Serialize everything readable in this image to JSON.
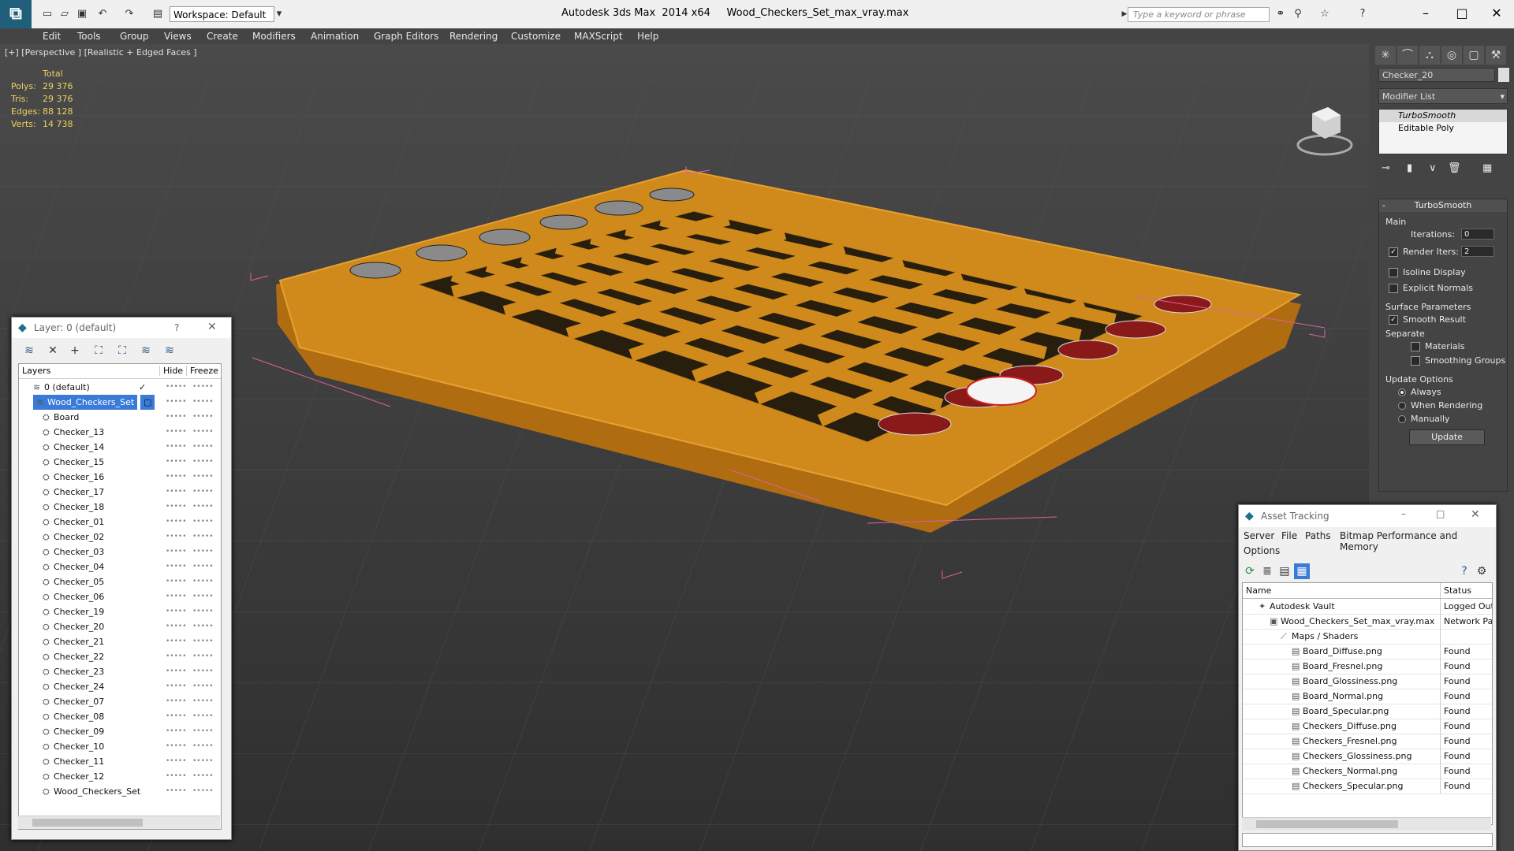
{
  "titlebar": {
    "app_title": "Autodesk 3ds Max  2014 x64     Wood_Checkers_Set_max_vray.max",
    "workspace": "Workspace: Default",
    "search_placeholder": "Type a keyword or phrase"
  },
  "menu": [
    "Edit",
    "Tools",
    "Group",
    "Views",
    "Create",
    "Modifiers",
    "Animation",
    "Graph Editors",
    "Rendering",
    "Customize",
    "MAXScript",
    "Help"
  ],
  "viewport": {
    "label": "[+] [Perspective ] [Realistic + Edged Faces ]",
    "stats": {
      "header": "Total",
      "polys_label": "Polys:",
      "polys": "29 376",
      "tris_label": "Tris:",
      "tris": "29 376",
      "edges_label": "Edges:",
      "edges": "88 128",
      "verts_label": "Verts:",
      "verts": "14 738"
    },
    "colors": {
      "board": "#d08a1c",
      "dark_square": "#0a0a0a",
      "checker_red": "#8a1a1a",
      "selection": "#e060a0"
    }
  },
  "command_panel": {
    "object_name": "Checker_20",
    "modifier_list": "Modifier List",
    "stack": [
      "TurboSmooth",
      "Editable Poly"
    ],
    "turbosmooth": {
      "title": "TurboSmooth",
      "main": "Main",
      "iterations_label": "Iterations:",
      "iterations": "0",
      "render_iters_label": "Render Iters:",
      "render_iters": "2",
      "isoline": "Isoline Display",
      "explicit_normals": "Explicit Normals",
      "surface_params": "Surface Parameters",
      "smooth_result": "Smooth Result",
      "separate": "Separate",
      "materials": "Materials",
      "smoothing_groups": "Smoothing Groups",
      "update_options": "Update Options",
      "always": "Always",
      "when_rendering": "When Rendering",
      "manually": "Manually",
      "update": "Update"
    }
  },
  "layer_dialog": {
    "title": "Layer: 0 (default)",
    "help": "?",
    "col_layers": "Layers",
    "col_hide": "Hide",
    "col_freeze": "Freeze",
    "rows": [
      {
        "name": "0 (default)",
        "level": 0
      },
      {
        "name": "Wood_Checkers_Set",
        "level": 0,
        "selected": true
      },
      {
        "name": "Board",
        "level": 1
      },
      {
        "name": "Checker_13",
        "level": 1
      },
      {
        "name": "Checker_14",
        "level": 1
      },
      {
        "name": "Checker_15",
        "level": 1
      },
      {
        "name": "Checker_16",
        "level": 1
      },
      {
        "name": "Checker_17",
        "level": 1
      },
      {
        "name": "Checker_18",
        "level": 1
      },
      {
        "name": "Checker_01",
        "level": 1
      },
      {
        "name": "Checker_02",
        "level": 1
      },
      {
        "name": "Checker_03",
        "level": 1
      },
      {
        "name": "Checker_04",
        "level": 1
      },
      {
        "name": "Checker_05",
        "level": 1
      },
      {
        "name": "Checker_06",
        "level": 1
      },
      {
        "name": "Checker_19",
        "level": 1
      },
      {
        "name": "Checker_20",
        "level": 1
      },
      {
        "name": "Checker_21",
        "level": 1
      },
      {
        "name": "Checker_22",
        "level": 1
      },
      {
        "name": "Checker_23",
        "level": 1
      },
      {
        "name": "Checker_24",
        "level": 1
      },
      {
        "name": "Checker_07",
        "level": 1
      },
      {
        "name": "Checker_08",
        "level": 1
      },
      {
        "name": "Checker_09",
        "level": 1
      },
      {
        "name": "Checker_10",
        "level": 1
      },
      {
        "name": "Checker_11",
        "level": 1
      },
      {
        "name": "Checker_12",
        "level": 1
      },
      {
        "name": "Wood_Checkers_Set",
        "level": 1
      }
    ]
  },
  "asset_dialog": {
    "title": "Asset Tracking",
    "menu": [
      "Server",
      "File",
      "Paths",
      "Bitmap Performance and Memory",
      "Options"
    ],
    "col_name": "Name",
    "col_status": "Status",
    "rows": [
      {
        "name": "Autodesk Vault",
        "status": "Logged Out",
        "level": 0
      },
      {
        "name": "Wood_Checkers_Set_max_vray.max",
        "status": "Network Pat",
        "level": 1
      },
      {
        "name": "Maps / Shaders",
        "status": "",
        "level": 2
      },
      {
        "name": "Board_Diffuse.png",
        "status": "Found",
        "level": 3
      },
      {
        "name": "Board_Fresnel.png",
        "status": "Found",
        "level": 3
      },
      {
        "name": "Board_Glossiness.png",
        "status": "Found",
        "level": 3
      },
      {
        "name": "Board_Normal.png",
        "status": "Found",
        "level": 3
      },
      {
        "name": "Board_Specular.png",
        "status": "Found",
        "level": 3
      },
      {
        "name": "Checkers_Diffuse.png",
        "status": "Found",
        "level": 3
      },
      {
        "name": "Checkers_Fresnel.png",
        "status": "Found",
        "level": 3
      },
      {
        "name": "Checkers_Glossiness.png",
        "status": "Found",
        "level": 3
      },
      {
        "name": "Checkers_Normal.png",
        "status": "Found",
        "level": 3
      },
      {
        "name": "Checkers_Specular.png",
        "status": "Found",
        "level": 3
      }
    ]
  }
}
